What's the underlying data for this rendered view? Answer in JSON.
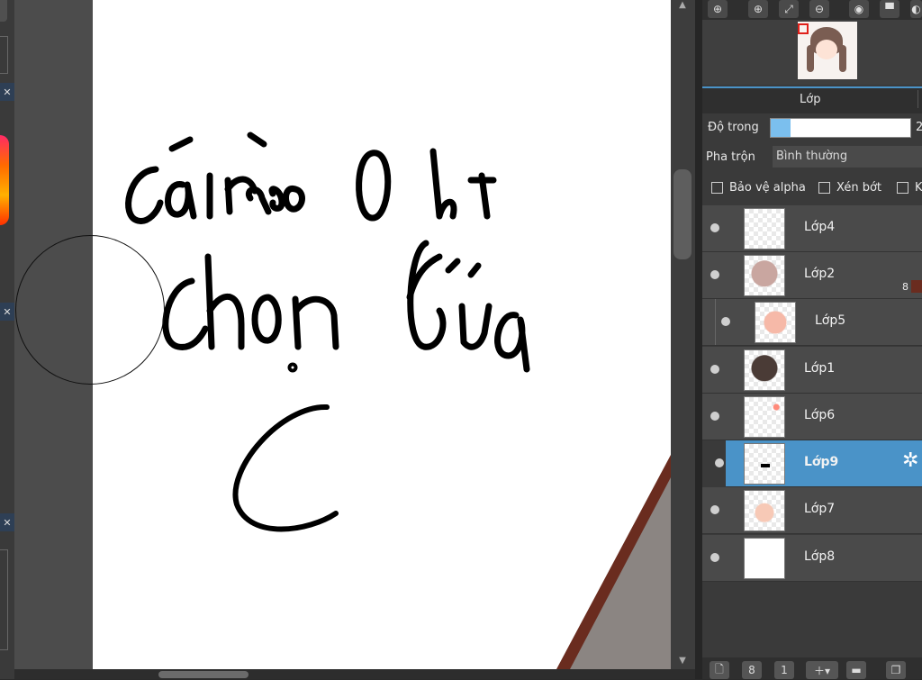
{
  "panel": {
    "tab_label": "Lớp",
    "opacity_label": "Độ trong",
    "opacity_value": "2",
    "opacity_fill": 0.14,
    "blend_label": "Pha trộn",
    "blend_value": "Bình thường",
    "checks": [
      "Bảo vệ alpha",
      "Xén bớt",
      "K"
    ],
    "side_number": "8",
    "accent_color": "#4a93c8"
  },
  "layers": [
    {
      "name": "Lớp4",
      "selected": false
    },
    {
      "name": "Lớp2",
      "selected": false
    },
    {
      "name": "Lớp5",
      "selected": false,
      "clipped": true
    },
    {
      "name": "Lớp1",
      "selected": false
    },
    {
      "name": "Lớp6",
      "selected": false
    },
    {
      "name": "Lớp9",
      "selected": true
    },
    {
      "name": "Lớp7",
      "selected": false
    },
    {
      "name": "Lớp8",
      "selected": false
    }
  ],
  "toolbar_icons": [
    "zoom-fit-icon",
    "zoom-in-icon",
    "fit-icon",
    "zoom-out-icon",
    "record-icon",
    "pin-icon",
    "more-icon"
  ],
  "bottom_icons": [
    "new-layer-icon",
    "new-8bit-layer-icon",
    "new-1bit-layer-icon",
    "add-layer-menu-icon",
    "folder-icon",
    "duplicate-icon"
  ],
  "canvas": {
    "handwriting_line1": "cái nào 0 bt",
    "handwriting_line2": "chọn lừa",
    "handwriting_line3": "C"
  }
}
